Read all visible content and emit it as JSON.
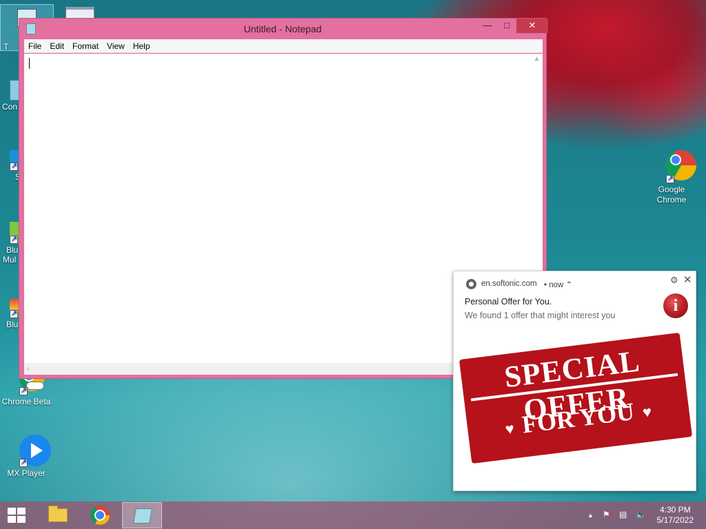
{
  "notepad": {
    "title": "Untitled - Notepad",
    "menu": [
      "File",
      "Edit",
      "Format",
      "View",
      "Help"
    ],
    "content": ""
  },
  "desktop": {
    "icons": [
      {
        "label": "Google Chrome",
        "icon": "chrome-icon"
      },
      {
        "label": "Chrome Beta",
        "icon": "chrome-beta-icon"
      },
      {
        "label": "MX Player",
        "icon": "mx-player-icon"
      }
    ],
    "partial_labels": [
      "T",
      "Con",
      "S",
      "Blu",
      "Mul",
      "Blu"
    ]
  },
  "notification": {
    "source": "en.softonic.com",
    "time": "• now",
    "title": "Personal Offer for You.",
    "body": "We found 1 offer that might interest you",
    "image_line1": "SPECIAL OFFER",
    "image_line2": "FOR YOU",
    "badge_letter": "i"
  },
  "taskbar": {
    "pinned": [
      "file-explorer",
      "google-chrome",
      "notepad"
    ],
    "active": "notepad",
    "tray_arrow": "▲",
    "time": "4:30 PM",
    "date": "5/17/2022"
  },
  "colors": {
    "window_frame": "#e3709e",
    "close_button": "#c7394e",
    "taskbar": "#a0506e",
    "stamp_red": "#b5121b"
  }
}
